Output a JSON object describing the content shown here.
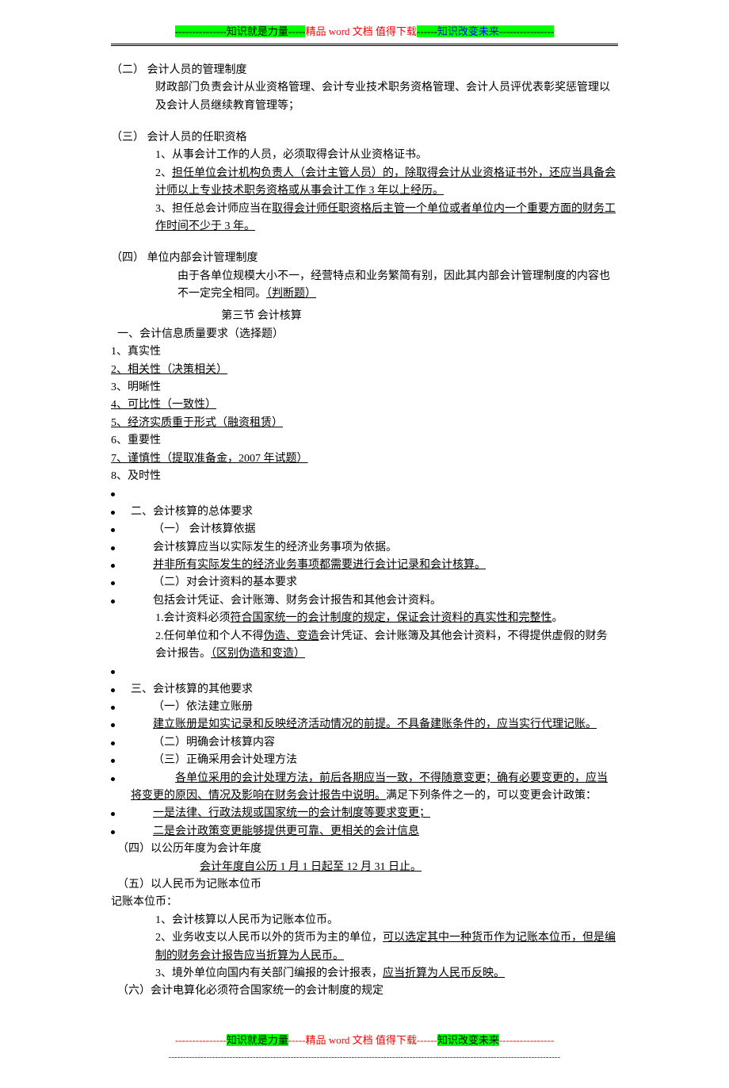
{
  "banner": {
    "dashes_a": "---------------",
    "p1": "知识就是力量",
    "dashes_b": "-----",
    "p2": "精品 word 文档  值得下载",
    "dashes_c": "------",
    "p3": "知识改变未来",
    "dashes_d": "----------------"
  },
  "s2": {
    "h": "（二）  会计人员的管理制度",
    "t": "财政部门负责会计从业资格管理、会计专业技术职务资格管理、会计人员评优表彰奖惩管理以及会计人员继续教育管理等；"
  },
  "s3": {
    "h": "（三）  会计人员的任职资格",
    "i1": "1、从事会计工作的人员，必须取得会计从业资格证书。",
    "i2a": "2、",
    "i2b": "担任单位会计机构负责人（会计主管人员）的，除取得会计从业资格证书外，还应当具备会计师以上专业技术职务资格或从事会计工作 3 年以上经历。",
    "i3a": "3、担任总会计师应当在",
    "i3b": "取得会计师任职资格后主管一个单位或者单位内一个重要方面的财务工作时间不少于 3 年。"
  },
  "s4": {
    "h": "（四）  单位内部会计管理制度",
    "ta": "由于各单位规模大小不一，经营特点和业务繁简有别，因此其内部会计管理制度的内容也不一定完全相同。",
    "tb": "（判断题）"
  },
  "sec3_title": "第三节  会计核算",
  "q1": {
    "h": "一、会计信息质量要求（选择题）",
    "i1": "1、真实性",
    "i2": "2、相关性（决策相关）",
    "i3": "3、明晰性",
    "i4": "4、可比性（一致性）",
    "i5": "5、经济实质重于形式（融资租赁）",
    "i6": "6、重要性",
    "i7": "7、谨慎性（提取准备金，2007 年试题）",
    "i8": "8、及时性"
  },
  "q2": {
    "h": "二、会计核算的总体要求",
    "s1": "（一）  会计核算依据",
    "t1": "会计核算应当以实际发生的经济业务事项为依据。",
    "t2": "并非所有实际发生的经济业务事项都需要进行会计记录和会计核算。",
    "s2": "（二）对会计资料的基本要求",
    "t3": "包括会计凭证、会计账簿、财务会计报告和其他会计资料。",
    "t4a": "1.会计资料必须",
    "t4b": "符合国家统一的会计制度的规定，保证会计资料的真实性和完整性",
    "t4c": "。",
    "t5a": "2.任何单位和个人不得",
    "t5b": "伪造、变造",
    "t5c": "会计凭证、会计账簿及其他会计资料，不得提供虚假的财务会计报告。",
    "t5d": "（区别伪造和变造）"
  },
  "q3": {
    "h": "三、会计核算的其他要求",
    "s1": "（一）依法建立账册",
    "t1": "建立账册是如实记录和反映经济活动情况的前提。不具备建账条件的，应当实行代理记账。",
    "s2": "（二）明确会计核算内容",
    "s3": "（三）正确采用会计处理方法",
    "t2a": "各单位采用的会计处理方法，前后各期应当一致，不得随意变更；确有必要变更的，应当将变更的原因、情况及影响在财务会计报告中说明。",
    "t2b": "满足下列条件之一的，可以变更会计政策：",
    "t3": "一是法律、行政法规或国家统一的会计制度等要求变更；",
    "t4": "二是会计政策变更能够提供更可靠、更相关的会计信息"
  },
  "s4b": {
    "h": "（四）以公历年度为会计年度",
    "t": "会计年度自公历 1 月 1 日起至 12 月 31 日止。"
  },
  "s5": {
    "h": "（五）以人民币为记账本位币",
    "t0": "记账本位币：",
    "t1": "1、会计核算以人民币为记账本位币。",
    "t2a": "2、业务收支以人民币以外的货币为主的单位，",
    "t2b": "可以选定其中一种货币作为记账本位币，但是编制的财务会计报告应当折算为人民币。",
    "t3a": "3、境外单位向国内有关部门编报的会计报表，",
    "t3b": "应当折算为人民币反映。"
  },
  "s6": {
    "h": "（六）会计电算化必须符合国家统一的会计制度的规定"
  },
  "footer_dashes": "---------------------------------------------------------------------------------------------------------------------------------------"
}
